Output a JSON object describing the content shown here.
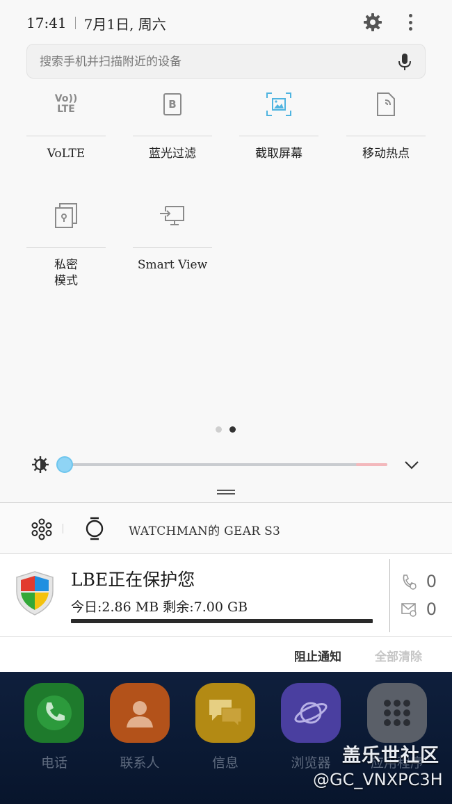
{
  "status": {
    "time": "17:41",
    "date": "7月1日, 周六"
  },
  "search": {
    "placeholder": "搜索手机并扫描附近的设备"
  },
  "tiles": [
    {
      "label": "VoLTE",
      "icon": "volte-icon"
    },
    {
      "label": "蓝光过滤",
      "icon": "blue-light-filter-icon"
    },
    {
      "label": "截取屏幕",
      "icon": "screenshot-icon"
    },
    {
      "label": "移动热点",
      "icon": "mobile-hotspot-icon"
    },
    {
      "label": "私密\n模式",
      "icon": "private-mode-icon"
    },
    {
      "label": "Smart View",
      "icon": "smart-view-icon"
    }
  ],
  "volte_icon_text": {
    "top": "Vo))",
    "bottom": "LTE"
  },
  "bluelight_icon_text": "B",
  "pages": {
    "count": 2,
    "current": 2
  },
  "brightness": {
    "level": 0.0
  },
  "device_bar": {
    "device_name": "WATCHMAN的 GEAR S3"
  },
  "notification": {
    "title": "LBE正在保护您",
    "subtitle": "今日:2.86 MB 剩余:7.00 GB",
    "calls_blocked": "0",
    "sms_blocked": "0"
  },
  "actions": {
    "block_label": "阻止通知",
    "clear_label": "全部清除"
  },
  "dock": {
    "apps": [
      {
        "label": "电话",
        "color": "#1e7a2c"
      },
      {
        "label": "联系人",
        "color": "#b3521a"
      },
      {
        "label": "信息",
        "color": "#b38a14"
      },
      {
        "label": "浏览器",
        "color": "#4a3fa0"
      },
      {
        "label": "应用程序",
        "color": "#5a5f68"
      }
    ]
  },
  "watermark": {
    "line1": "盖乐世社区",
    "line2": "@GC_VNXPC3H"
  },
  "colors": {
    "accent": "#4fb4e0",
    "brightness_thumb": "#8fd4f5"
  }
}
